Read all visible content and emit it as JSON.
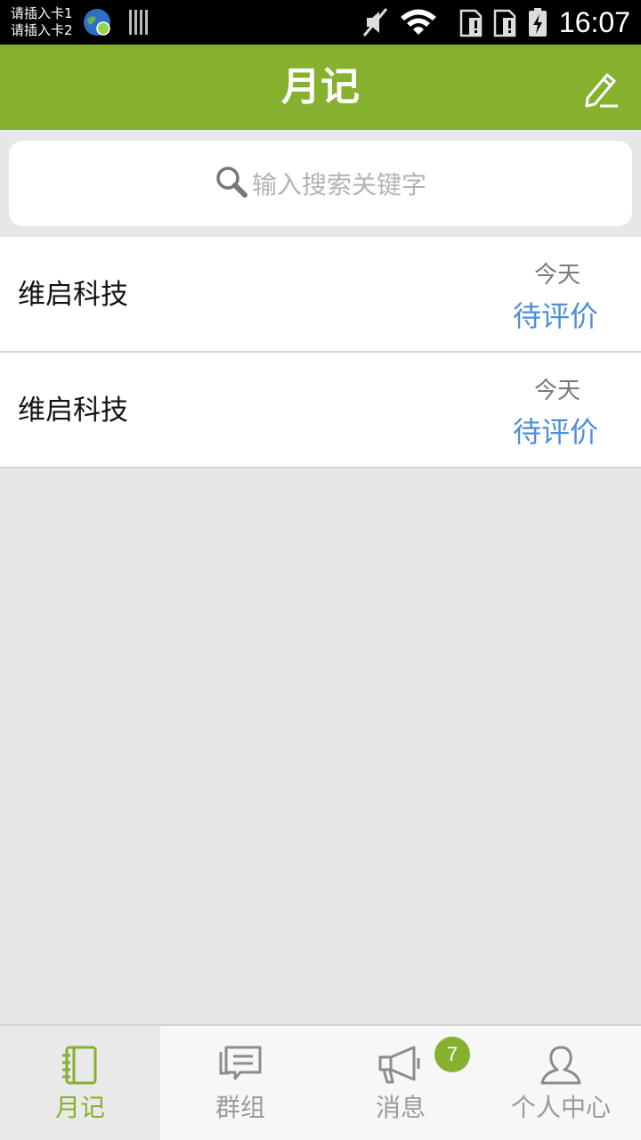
{
  "status_bar": {
    "sim1": "请插入卡1",
    "sim2": "请插入卡2",
    "time": "16:07"
  },
  "header": {
    "title": "月记",
    "edit_icon": "edit-pencil-icon"
  },
  "search": {
    "placeholder": "输入搜索关键字",
    "icon": "search-icon"
  },
  "list": [
    {
      "title": "维启科技",
      "date": "今天",
      "status": "待评价"
    },
    {
      "title": "维启科技",
      "date": "今天",
      "status": "待评价"
    }
  ],
  "bottom_nav": {
    "items": [
      {
        "label": "月记",
        "icon": "notebook-icon",
        "active": true
      },
      {
        "label": "群组",
        "icon": "chat-group-icon"
      },
      {
        "label": "消息",
        "icon": "megaphone-icon",
        "badge": "7"
      },
      {
        "label": "个人中心",
        "icon": "person-icon"
      }
    ]
  },
  "colors": {
    "brand": "#86b12e",
    "status_link": "#4f8fd6"
  }
}
